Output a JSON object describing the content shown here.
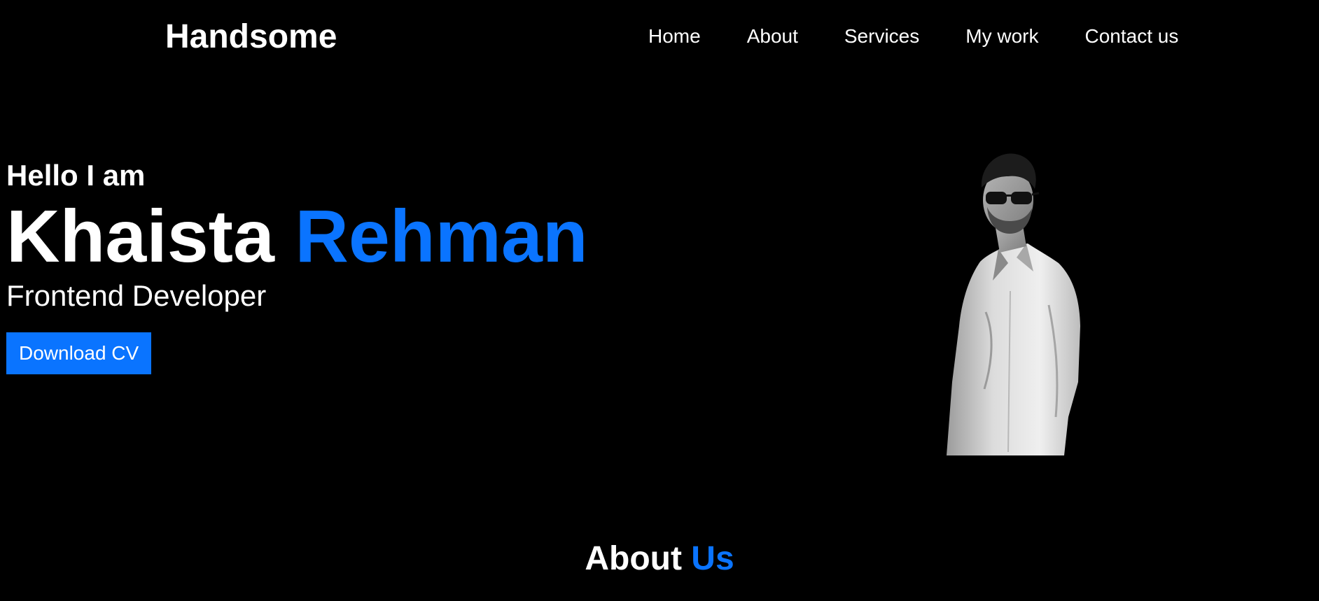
{
  "header": {
    "logo": "Handsome",
    "nav": [
      {
        "label": "Home"
      },
      {
        "label": "About"
      },
      {
        "label": "Services"
      },
      {
        "label": "My work"
      },
      {
        "label": "Contact us"
      }
    ]
  },
  "hero": {
    "greeting": "Hello I am",
    "first_name": "Khaista",
    "last_name": "Rehman",
    "role": "Frontend Developer",
    "cta_label": "Download CV"
  },
  "about": {
    "heading_main": "About",
    "heading_accent": "Us"
  },
  "colors": {
    "background": "#000000",
    "accent": "#0a74ff",
    "text": "#ffffff"
  }
}
